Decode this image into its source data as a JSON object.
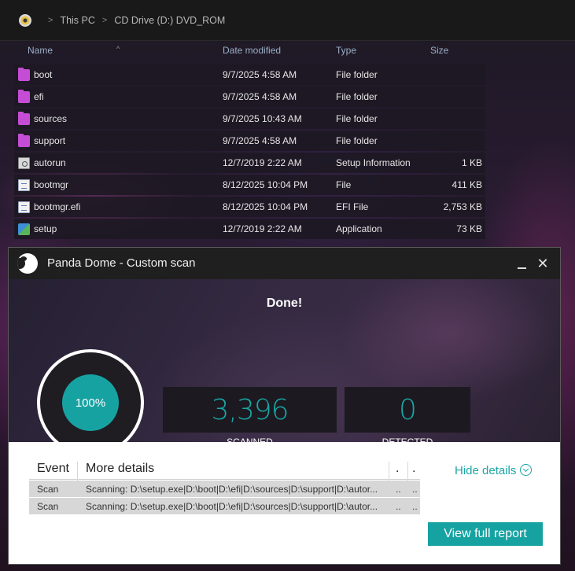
{
  "explorer": {
    "breadcrumb": [
      "This PC",
      "CD Drive (D:) DVD_ROM"
    ],
    "columns": {
      "name": "Name",
      "date": "Date modified",
      "type": "Type",
      "size": "Size"
    },
    "files": [
      {
        "name": "boot",
        "date": "9/7/2025 4:58 AM",
        "type": "File folder",
        "size": "",
        "icon": "folder-icon"
      },
      {
        "name": "efi",
        "date": "9/7/2025 4:58 AM",
        "type": "File folder",
        "size": "",
        "icon": "folder-icon"
      },
      {
        "name": "sources",
        "date": "9/7/2025 10:43 AM",
        "type": "File folder",
        "size": "",
        "icon": "folder-icon"
      },
      {
        "name": "support",
        "date": "9/7/2025 4:58 AM",
        "type": "File folder",
        "size": "",
        "icon": "folder-icon"
      },
      {
        "name": "autorun",
        "date": "12/7/2019 2:22 AM",
        "type": "Setup Information",
        "size": "1 KB",
        "icon": "setup-info-icon"
      },
      {
        "name": "bootmgr",
        "date": "8/12/2025 10:04 PM",
        "type": "File",
        "size": "411 KB",
        "icon": "file-icon"
      },
      {
        "name": "bootmgr.efi",
        "date": "8/12/2025 10:04 PM",
        "type": "EFI File",
        "size": "2,753 KB",
        "icon": "file-icon"
      },
      {
        "name": "setup",
        "date": "12/7/2019 2:22 AM",
        "type": "Application",
        "size": "73 KB",
        "icon": "application-icon"
      }
    ]
  },
  "dialog": {
    "title": "Panda Dome - Custom scan",
    "status": "Done!",
    "progress_label": "100%",
    "progress_fraction": 1.0,
    "scanned_value": "3,396",
    "scanned_label": "SCANNED",
    "detected_value": "0",
    "detected_label": "DETECTED",
    "table": {
      "headers": [
        "Event",
        "More details",
        ".",
        "."
      ],
      "rows": [
        [
          "Scan",
          "Scanning: D:\\setup.exe|D:\\boot|D:\\efi|D:\\sources|D:\\support|D:\\autor...",
          "..",
          ".."
        ],
        [
          "Scan",
          "Scanning: D:\\setup.exe|D:\\boot|D:\\efi|D:\\sources|D:\\support|D:\\autor...",
          "..",
          ".."
        ]
      ]
    },
    "hide_details_label": "Hide details",
    "view_report_label": "View full report",
    "accent_color": "#17a2a2"
  }
}
